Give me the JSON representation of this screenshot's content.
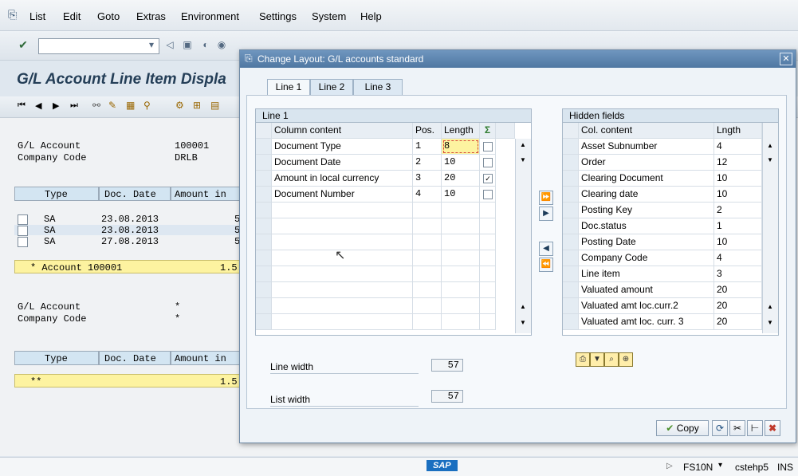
{
  "menu": {
    "items": [
      "List",
      "Edit",
      "Goto",
      "Extras",
      "Environment",
      "Settings",
      "System",
      "Help"
    ]
  },
  "bg": {
    "title": "G/L Account Line Item Displa",
    "account_block1": {
      "gl_label": "G/L Account",
      "gl_value": "100001",
      "cc_label": "Company Code",
      "cc_value": "DRLB"
    },
    "table1": {
      "headers": [
        "Type",
        "Doc. Date",
        "Amount in"
      ],
      "rows": [
        {
          "type": "SA",
          "date": "23.08.2013",
          "amt": "5"
        },
        {
          "type": "SA",
          "date": "23.08.2013",
          "amt": "5"
        },
        {
          "type": "SA",
          "date": "27.08.2013",
          "amt": "5"
        }
      ],
      "subtotal_label": "* Account 100001",
      "subtotal_value": "1.5"
    },
    "account_block2": {
      "gl_label": "G/L Account",
      "gl_value": "*",
      "cc_label": "Company Code",
      "cc_value": "*"
    },
    "table2": {
      "headers": [
        "Type",
        "Doc. Date",
        "Amount in"
      ],
      "total_label": "**",
      "total_value": "1.5"
    }
  },
  "status": {
    "brand": "SAP",
    "transaction": "FS10N",
    "server": "cstehp5",
    "mode": "INS"
  },
  "dialog": {
    "title": "Change Layout: G/L accounts standard",
    "tabs": [
      "Line 1",
      "Line 2",
      "Line 3"
    ],
    "left_grid": {
      "title": "Line 1",
      "headers": [
        "Column content",
        "Pos.",
        "Length"
      ],
      "rows": [
        {
          "content": "Document Type",
          "pos": "1",
          "length": "8",
          "check": false
        },
        {
          "content": "Document Date",
          "pos": "2",
          "length": "10",
          "check": false
        },
        {
          "content": "Amount in local currency",
          "pos": "3",
          "length": "20",
          "check": true
        },
        {
          "content": "Document Number",
          "pos": "4",
          "length": "10",
          "check": false
        }
      ]
    },
    "right_grid": {
      "title": "Hidden fields",
      "headers": [
        "Col. content",
        "Lngth"
      ],
      "rows": [
        {
          "content": "Asset Subnumber",
          "len": "4"
        },
        {
          "content": "Order",
          "len": "12"
        },
        {
          "content": "Clearing Document",
          "len": "10"
        },
        {
          "content": "Clearing date",
          "len": "10"
        },
        {
          "content": "Posting Key",
          "len": "2"
        },
        {
          "content": "Doc.status",
          "len": "1"
        },
        {
          "content": "Posting Date",
          "len": "10"
        },
        {
          "content": "Company Code",
          "len": "4"
        },
        {
          "content": "Line item",
          "len": "3"
        },
        {
          "content": "Valuated amount",
          "len": "20"
        },
        {
          "content": "Valuated amt loc.curr.2",
          "len": "20"
        },
        {
          "content": "Valuated amt loc. curr. 3",
          "len": "20"
        }
      ]
    },
    "line_width_label": "Line width",
    "line_width_value": "57",
    "list_width_label": "List width",
    "list_width_value": "57",
    "copy_label": "Copy"
  },
  "colors": {
    "accent": "#4f77a2",
    "highlight_yellow": "#fdf3a0",
    "header_blue": "#d3e5f2",
    "close_red": "#c0392b"
  }
}
